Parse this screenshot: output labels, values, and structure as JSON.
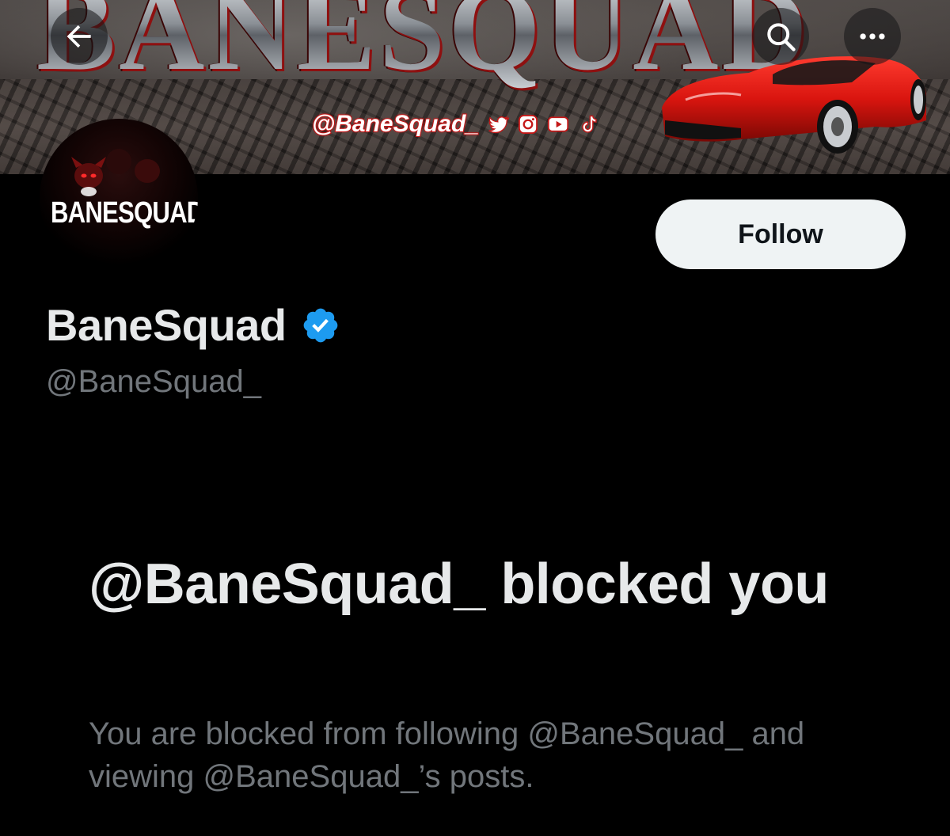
{
  "banner": {
    "logo_text": "BANESQUAD",
    "social_handle": "@BaneSquad_"
  },
  "avatar": {
    "text": "BANESQUAD"
  },
  "header": {
    "back_icon": "arrow-left-icon",
    "search_icon": "search-icon",
    "more_icon": "more-horizontal-icon"
  },
  "profile": {
    "display_name": "BaneSquad",
    "handle": "@BaneSquad_",
    "verified": true,
    "verified_color": "#1d9bf0"
  },
  "actions": {
    "follow_label": "Follow"
  },
  "blocked": {
    "title": "@BaneSquad_ blocked you",
    "subtitle": "You are blocked from following @BaneSquad_ and viewing @BaneSquad_’s posts."
  },
  "colors": {
    "background": "#000000",
    "primary_text": "#e7e9ea",
    "secondary_text": "#71767b",
    "follow_bg": "#eff3f4",
    "follow_text": "#0f1419",
    "accent_red": "#c41818"
  }
}
